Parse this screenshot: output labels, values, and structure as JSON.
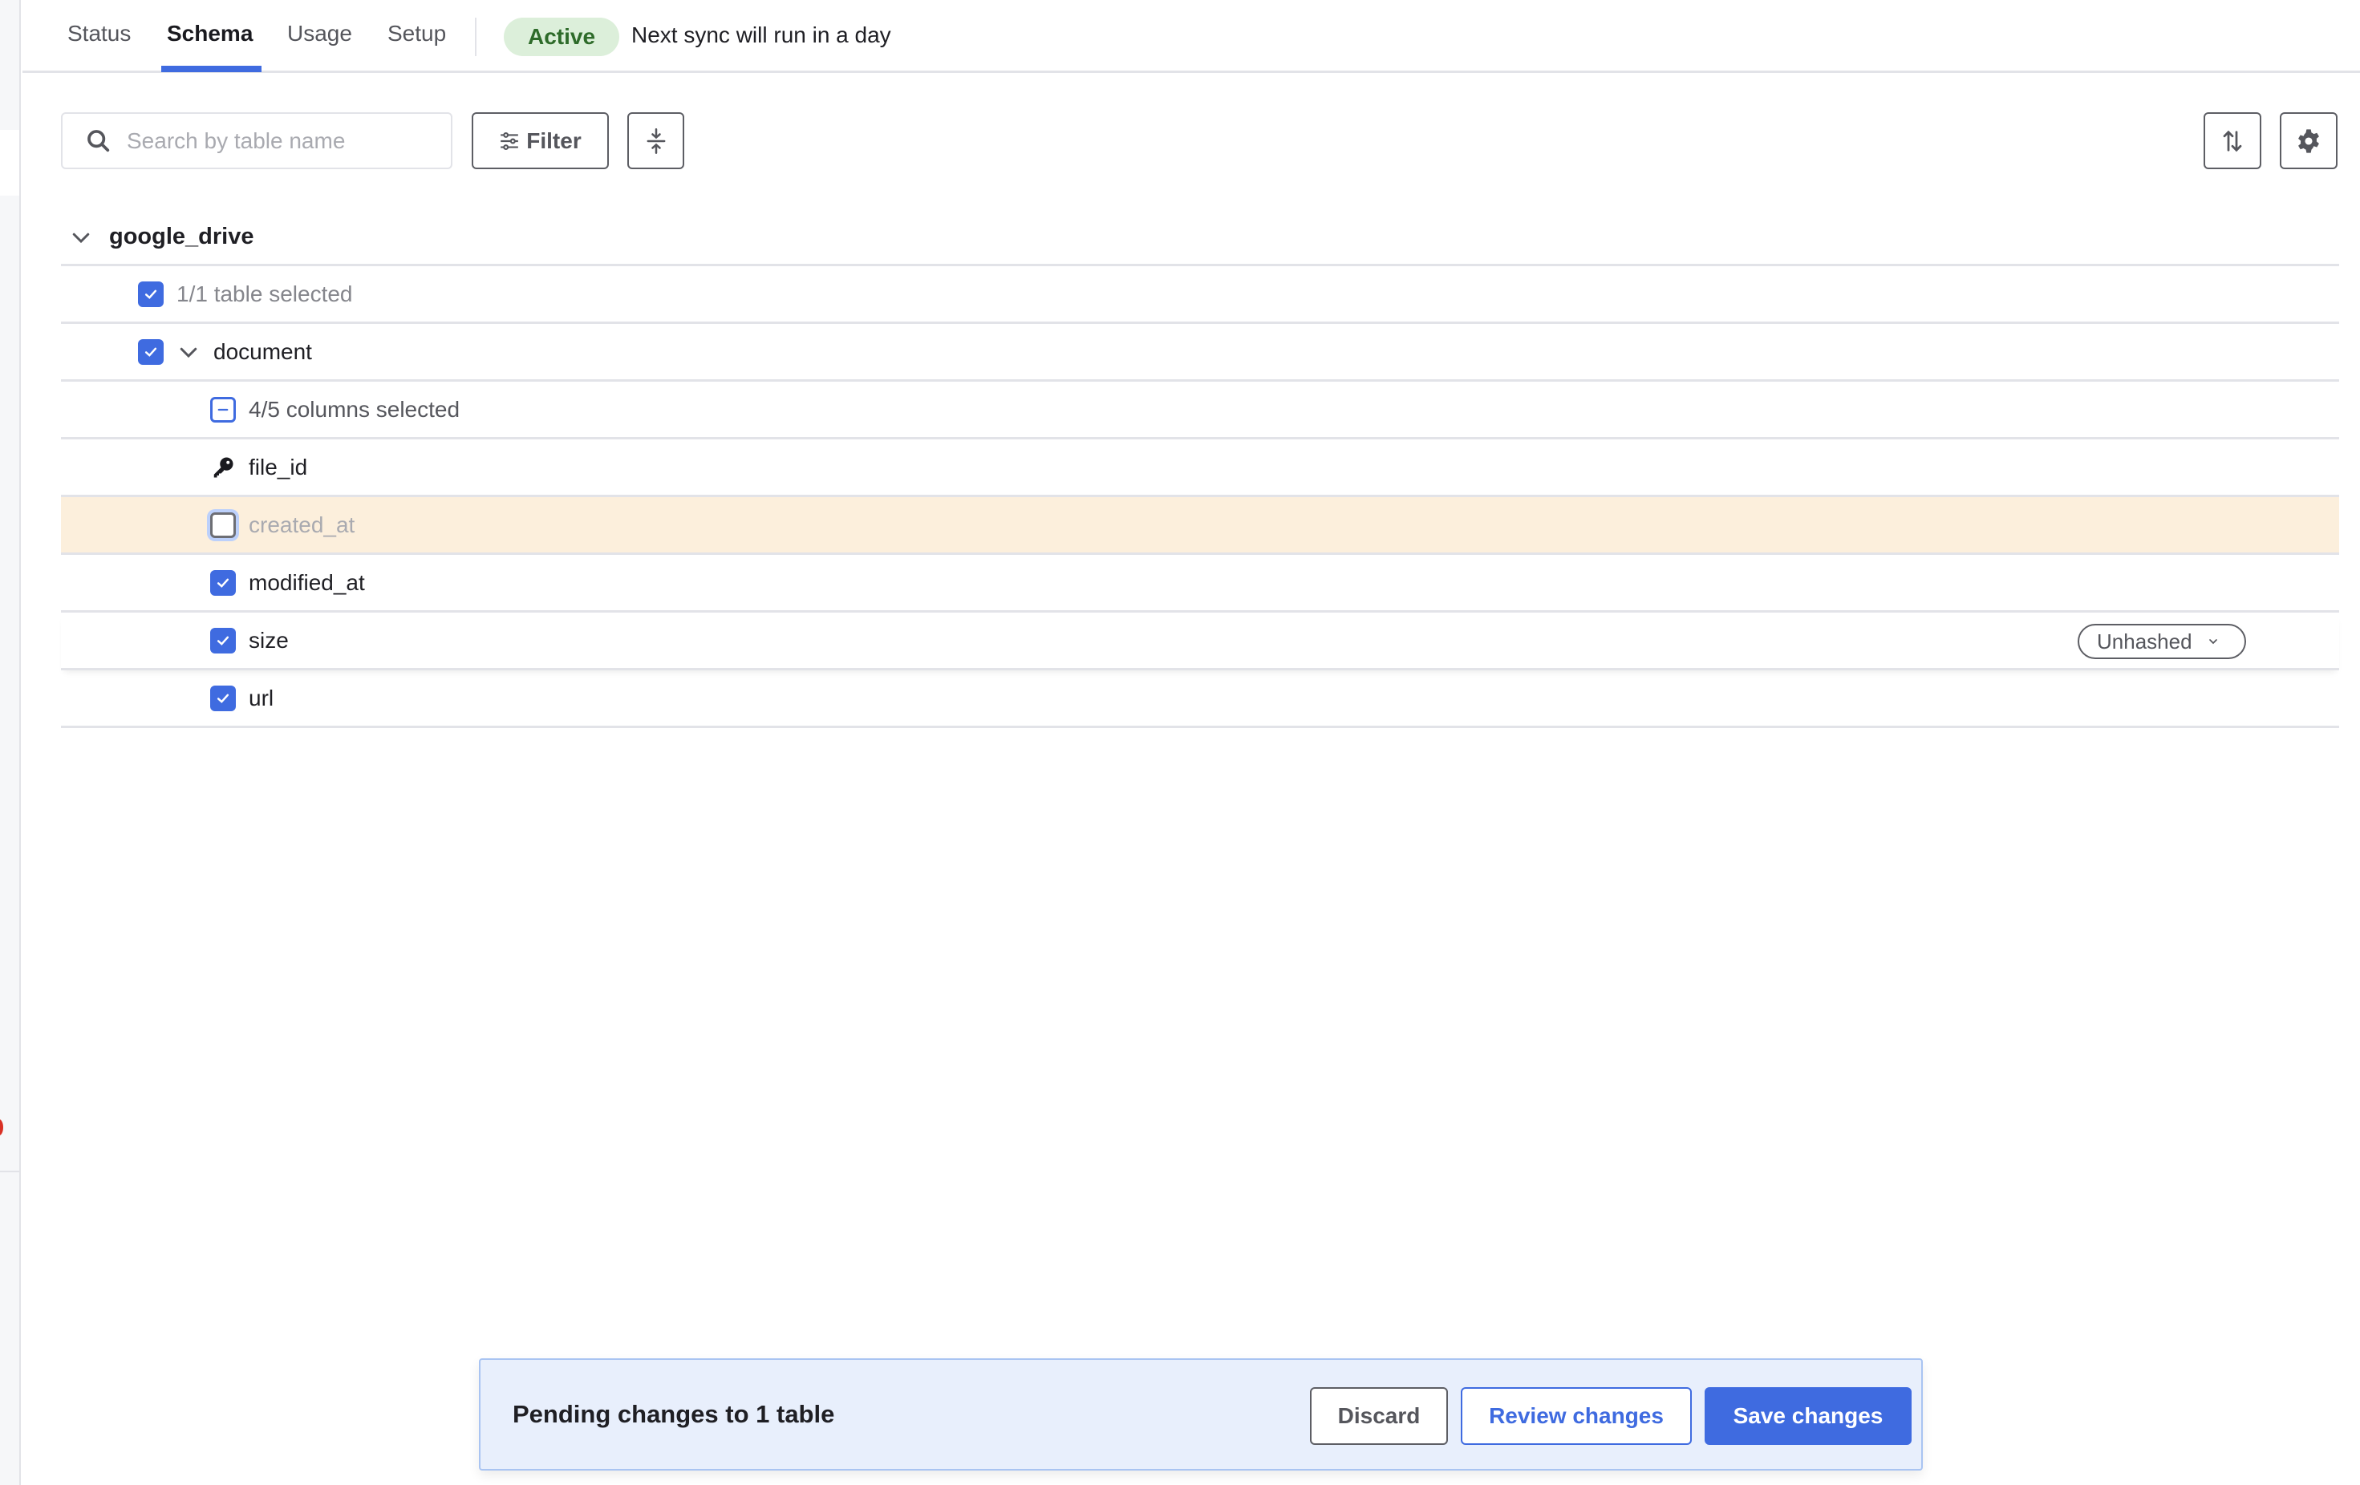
{
  "tabs": [
    {
      "label": "Status",
      "active": false
    },
    {
      "label": "Schema",
      "active": true
    },
    {
      "label": "Usage",
      "active": false
    },
    {
      "label": "Setup",
      "active": false
    }
  ],
  "status": {
    "badge": "Active",
    "sync_text": "Next sync will run in a day",
    "badge_color": "#2e6b2a",
    "badge_bg": "#dcefda"
  },
  "toolbar": {
    "search_placeholder": "Search by table name",
    "search_value": "",
    "filter_label": "Filter",
    "collapse_icon": "collapse-all-icon",
    "sort_icon": "sort-icon",
    "settings_icon": "gear-icon"
  },
  "schema": {
    "name": "google_drive",
    "expanded": true,
    "tables_summary": "1/1 table selected",
    "tables": [
      {
        "name": "document",
        "checked": true,
        "expanded": true,
        "columns_summary": "4/5 columns selected",
        "columns": [
          {
            "name": "file_id",
            "state": "primary-key",
            "icon": "key-icon"
          },
          {
            "name": "created_at",
            "state": "unchecked",
            "changed": true
          },
          {
            "name": "modified_at",
            "state": "checked"
          },
          {
            "name": "size",
            "state": "checked",
            "hashing": "Unhashed"
          },
          {
            "name": "url",
            "state": "checked"
          }
        ]
      }
    ]
  },
  "pending": {
    "title": "Pending changes to 1 table",
    "discard_label": "Discard",
    "review_label": "Review changes",
    "save_label": "Save changes"
  },
  "colors": {
    "accent": "#3f6be0",
    "changed_row": "#fcefdc",
    "pending_bg": "#e8effc"
  }
}
